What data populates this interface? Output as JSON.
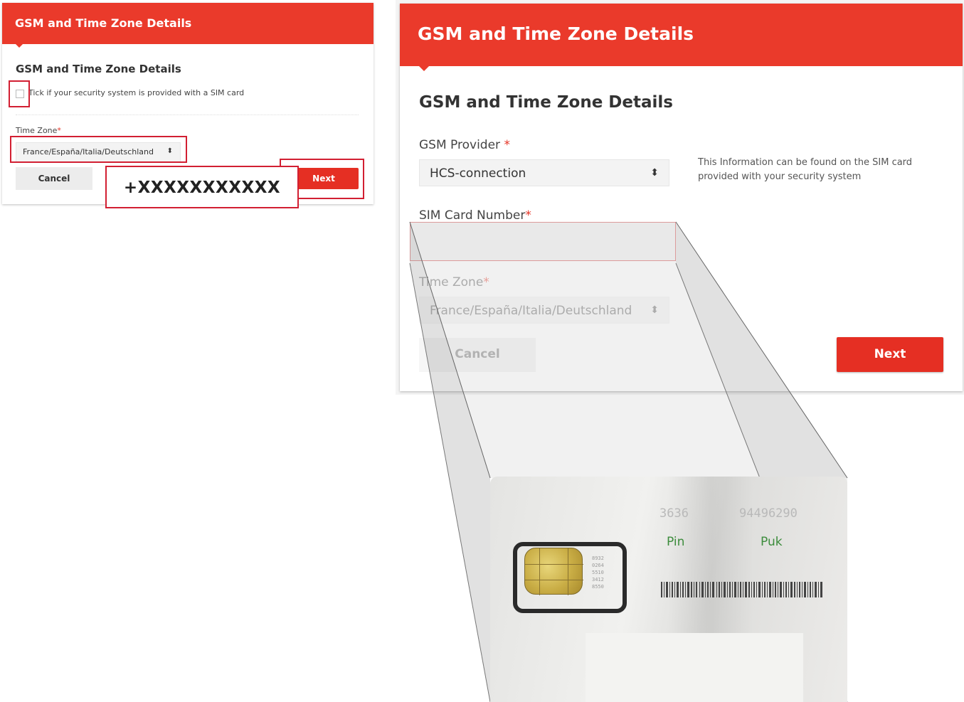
{
  "small_panel": {
    "header_title": "GSM and Time Zone Details",
    "subtitle": "GSM and Time Zone Details",
    "sim_checkbox_label": "Tick if your security system is provided with a SIM card",
    "sim_checkbox_checked": false,
    "time_zone_label": "Time Zone",
    "required_mark": "*",
    "time_zone_value": "France/España/Italia/Deutschland",
    "select_arrow": "⬍",
    "cancel_label": "Cancel",
    "next_label": "Next"
  },
  "large_panel": {
    "header_title": "GSM and Time Zone Details",
    "subtitle": "GSM and Time Zone Details",
    "gsm_provider_label": "GSM Provider",
    "required_mark": "*",
    "gsm_provider_value": "HCS-connection",
    "select_arrow": "⬍",
    "info_text": "This Information can be found on the SIM card provided with your security system",
    "sim_number_label": "SIM Card Number",
    "sim_number_value": "",
    "time_zone_label": "Time Zone",
    "time_zone_value": "France/España/Italia/Deutschland",
    "cancel_label": "Cancel",
    "next_label": "Next"
  },
  "sim_card": {
    "pin_number": "3636",
    "puk_number": "94496290",
    "pin_label": "Pin",
    "puk_label": "Puk",
    "serial_lines": [
      "8932",
      "0264",
      "5510",
      "3412",
      "8550"
    ],
    "phone_number": "+XXXXXXXXXXX"
  },
  "colors": {
    "brand_red": "#ea3a2b",
    "button_red": "#e52f23",
    "highlight_red": "#d21f32",
    "required_red": "#e53425",
    "pin_green": "#3c8c3c"
  }
}
